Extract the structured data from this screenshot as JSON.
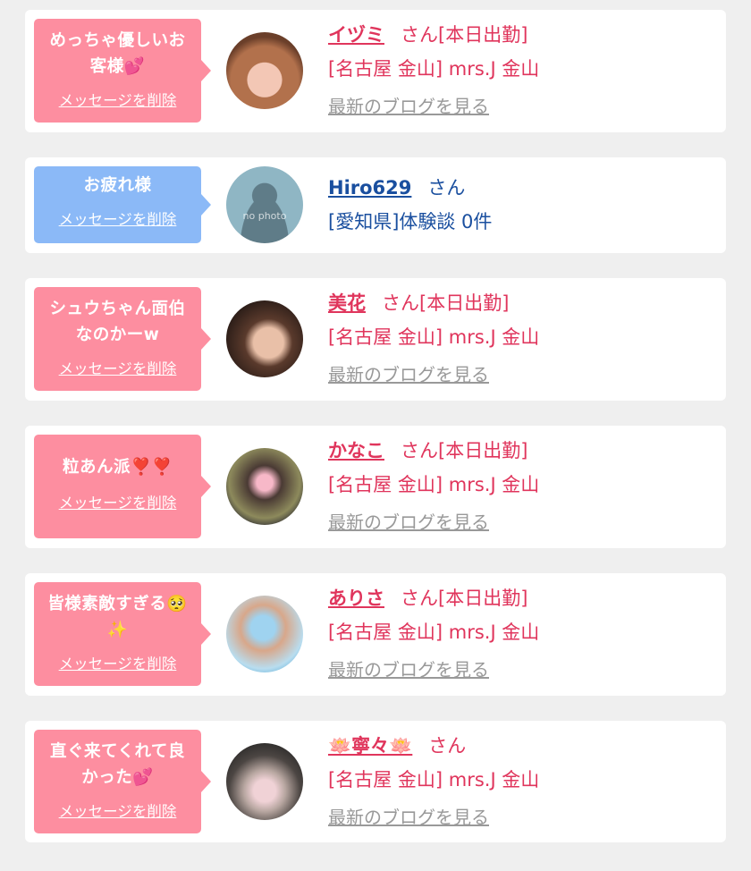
{
  "common": {
    "delete_label": "メッセージを削除",
    "blog_label": "最新のブログを見る",
    "san": "さん",
    "on_duty": "[本日出勤]",
    "shop": "[名古屋 金山] mrs.J 金山"
  },
  "cards": [
    {
      "message_l1": "めっちゃ優しいお",
      "message_l2": "客様💕",
      "name": "イヅミ"
    },
    {
      "message_l1": "お疲れ様",
      "name": "Hiro629",
      "detail": "[愛知県]体験談 0件",
      "avatar_text": "no photo"
    },
    {
      "message_l1": "シュウちゃん面伯",
      "message_l2": "なのかーw",
      "name": "美花"
    },
    {
      "message_l1": "粒あん派❣️❣️",
      "name": "かなこ"
    },
    {
      "message_l1": "皆様素敵すぎる🥺",
      "message_l2": "✨",
      "name": "ありさ"
    },
    {
      "message_l1": "直ぐ来てくれて良",
      "message_l2": "かった💕",
      "name": "🪷寧々🪷"
    }
  ],
  "colors": {
    "pink_bubble": "#fd8ea0",
    "blue_bubble": "#8bb9f7",
    "name_red": "#e0355c",
    "name_navy": "#1a4f9f",
    "link_gray": "#999999",
    "background": "#efefef"
  }
}
